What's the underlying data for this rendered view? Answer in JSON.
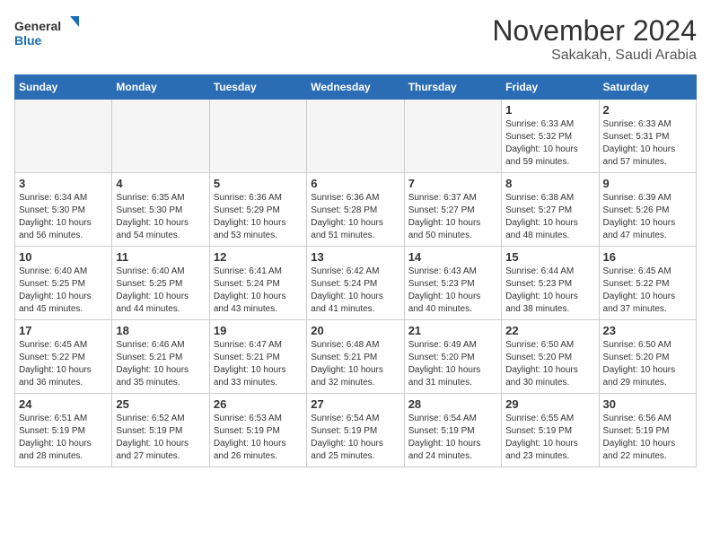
{
  "header": {
    "logo_line1": "General",
    "logo_line2": "Blue",
    "month_title": "November 2024",
    "subtitle": "Sakakah, Saudi Arabia"
  },
  "weekdays": [
    "Sunday",
    "Monday",
    "Tuesday",
    "Wednesday",
    "Thursday",
    "Friday",
    "Saturday"
  ],
  "weeks": [
    [
      {
        "day": "",
        "info": ""
      },
      {
        "day": "",
        "info": ""
      },
      {
        "day": "",
        "info": ""
      },
      {
        "day": "",
        "info": ""
      },
      {
        "day": "",
        "info": ""
      },
      {
        "day": "1",
        "info": "Sunrise: 6:33 AM\nSunset: 5:32 PM\nDaylight: 10 hours and 59 minutes."
      },
      {
        "day": "2",
        "info": "Sunrise: 6:33 AM\nSunset: 5:31 PM\nDaylight: 10 hours and 57 minutes."
      }
    ],
    [
      {
        "day": "3",
        "info": "Sunrise: 6:34 AM\nSunset: 5:30 PM\nDaylight: 10 hours and 56 minutes."
      },
      {
        "day": "4",
        "info": "Sunrise: 6:35 AM\nSunset: 5:30 PM\nDaylight: 10 hours and 54 minutes."
      },
      {
        "day": "5",
        "info": "Sunrise: 6:36 AM\nSunset: 5:29 PM\nDaylight: 10 hours and 53 minutes."
      },
      {
        "day": "6",
        "info": "Sunrise: 6:36 AM\nSunset: 5:28 PM\nDaylight: 10 hours and 51 minutes."
      },
      {
        "day": "7",
        "info": "Sunrise: 6:37 AM\nSunset: 5:27 PM\nDaylight: 10 hours and 50 minutes."
      },
      {
        "day": "8",
        "info": "Sunrise: 6:38 AM\nSunset: 5:27 PM\nDaylight: 10 hours and 48 minutes."
      },
      {
        "day": "9",
        "info": "Sunrise: 6:39 AM\nSunset: 5:26 PM\nDaylight: 10 hours and 47 minutes."
      }
    ],
    [
      {
        "day": "10",
        "info": "Sunrise: 6:40 AM\nSunset: 5:25 PM\nDaylight: 10 hours and 45 minutes."
      },
      {
        "day": "11",
        "info": "Sunrise: 6:40 AM\nSunset: 5:25 PM\nDaylight: 10 hours and 44 minutes."
      },
      {
        "day": "12",
        "info": "Sunrise: 6:41 AM\nSunset: 5:24 PM\nDaylight: 10 hours and 43 minutes."
      },
      {
        "day": "13",
        "info": "Sunrise: 6:42 AM\nSunset: 5:24 PM\nDaylight: 10 hours and 41 minutes."
      },
      {
        "day": "14",
        "info": "Sunrise: 6:43 AM\nSunset: 5:23 PM\nDaylight: 10 hours and 40 minutes."
      },
      {
        "day": "15",
        "info": "Sunrise: 6:44 AM\nSunset: 5:23 PM\nDaylight: 10 hours and 38 minutes."
      },
      {
        "day": "16",
        "info": "Sunrise: 6:45 AM\nSunset: 5:22 PM\nDaylight: 10 hours and 37 minutes."
      }
    ],
    [
      {
        "day": "17",
        "info": "Sunrise: 6:45 AM\nSunset: 5:22 PM\nDaylight: 10 hours and 36 minutes."
      },
      {
        "day": "18",
        "info": "Sunrise: 6:46 AM\nSunset: 5:21 PM\nDaylight: 10 hours and 35 minutes."
      },
      {
        "day": "19",
        "info": "Sunrise: 6:47 AM\nSunset: 5:21 PM\nDaylight: 10 hours and 33 minutes."
      },
      {
        "day": "20",
        "info": "Sunrise: 6:48 AM\nSunset: 5:21 PM\nDaylight: 10 hours and 32 minutes."
      },
      {
        "day": "21",
        "info": "Sunrise: 6:49 AM\nSunset: 5:20 PM\nDaylight: 10 hours and 31 minutes."
      },
      {
        "day": "22",
        "info": "Sunrise: 6:50 AM\nSunset: 5:20 PM\nDaylight: 10 hours and 30 minutes."
      },
      {
        "day": "23",
        "info": "Sunrise: 6:50 AM\nSunset: 5:20 PM\nDaylight: 10 hours and 29 minutes."
      }
    ],
    [
      {
        "day": "24",
        "info": "Sunrise: 6:51 AM\nSunset: 5:19 PM\nDaylight: 10 hours and 28 minutes."
      },
      {
        "day": "25",
        "info": "Sunrise: 6:52 AM\nSunset: 5:19 PM\nDaylight: 10 hours and 27 minutes."
      },
      {
        "day": "26",
        "info": "Sunrise: 6:53 AM\nSunset: 5:19 PM\nDaylight: 10 hours and 26 minutes."
      },
      {
        "day": "27",
        "info": "Sunrise: 6:54 AM\nSunset: 5:19 PM\nDaylight: 10 hours and 25 minutes."
      },
      {
        "day": "28",
        "info": "Sunrise: 6:54 AM\nSunset: 5:19 PM\nDaylight: 10 hours and 24 minutes."
      },
      {
        "day": "29",
        "info": "Sunrise: 6:55 AM\nSunset: 5:19 PM\nDaylight: 10 hours and 23 minutes."
      },
      {
        "day": "30",
        "info": "Sunrise: 6:56 AM\nSunset: 5:19 PM\nDaylight: 10 hours and 22 minutes."
      }
    ]
  ]
}
